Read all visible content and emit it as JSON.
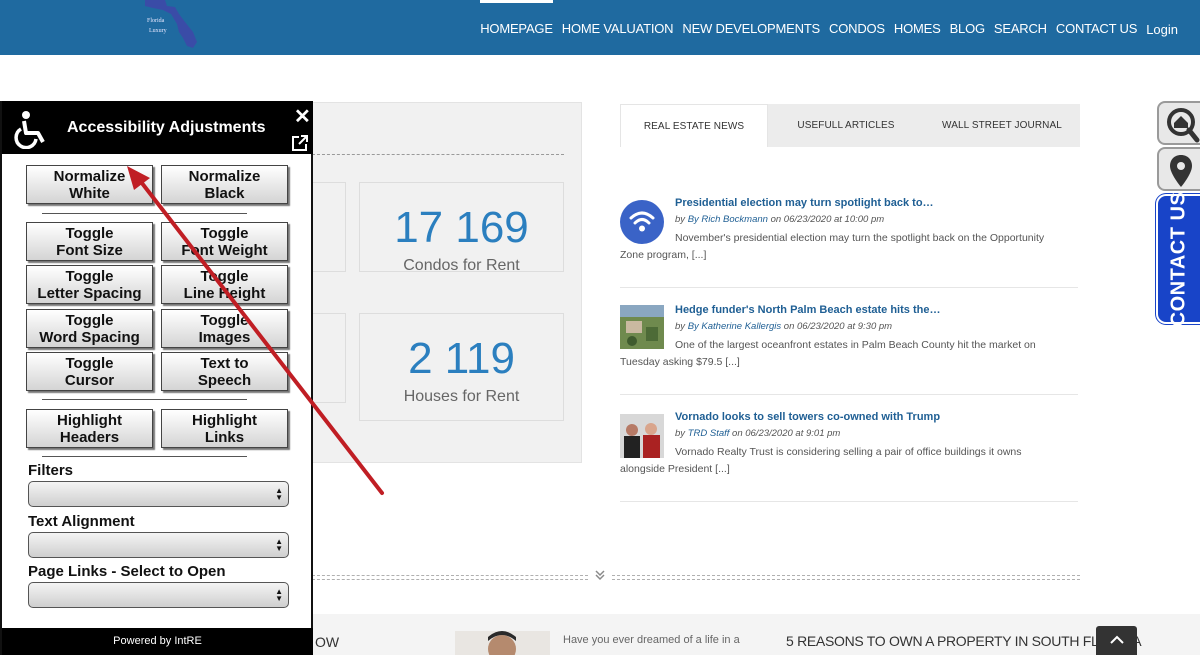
{
  "colors": {
    "header_bg": "#1f6aa0",
    "stat_number": "#2b7fbf",
    "link": "#1f5f94",
    "contact_tab": "#1844c8",
    "arrow": "#c01e24"
  },
  "nav": {
    "items": [
      "HOMEPAGE",
      "HOME VALUATION",
      "NEW DEVELOPMENTS",
      "CONDOS",
      "HOMES",
      "BLOG",
      "SEARCH",
      "CONTACT US"
    ],
    "login": "Login"
  },
  "stats": [
    {
      "number": "17 169",
      "label": "Condos for Rent"
    },
    {
      "number": "2 119",
      "label": "Houses for Rent"
    }
  ],
  "tabs": [
    "REAL ESTATE NEWS",
    "USEFULL ARTICLES",
    "WALL STREET JOURNAL"
  ],
  "news": [
    {
      "title": "Presidential election may turn spotlight back to…",
      "by": "by",
      "author": "By Rich Bockmann",
      "date": "on 06/23/2020 at 10:00 pm",
      "excerpt": "November's presidential election may turn the spotlight back on the Opportunity Zone program, [...]",
      "thumb": "wifi-feed-icon"
    },
    {
      "title": "Hedge funder's North Palm Beach estate hits the…",
      "by": "by",
      "author": "By Katherine Kallergis",
      "date": "on 06/23/2020 at 9:30 pm",
      "excerpt": "One of the largest oceanfront estates in Palm Beach County hit the market on Tuesday asking $79.5 [...]",
      "thumb": "aerial-photo"
    },
    {
      "title": "Vornado looks to sell towers co-owned with Trump",
      "by": "by",
      "author": "TRD Staff",
      "date": "on 06/23/2020 at 9:01 pm",
      "excerpt": "Vornado Realty Trust is considering selling a pair of office buildings it owns alongside President [...]",
      "thumb": "people-photo"
    }
  ],
  "bottom": {
    "partial_heading": "OW",
    "text": "Have you ever dreamed of a life in a",
    "heading": "5 REASONS TO OWN A PROPERTY IN SOUTH FLORIDA"
  },
  "side": {
    "contact_label": "CONTACT US",
    "icons": [
      "home-search-icon",
      "map-pin-icon"
    ]
  },
  "a11y": {
    "title": "Accessibility Adjustments",
    "buttons": [
      [
        "Normalize",
        "White"
      ],
      [
        "Normalize",
        "Black"
      ],
      [
        "Toggle",
        "Font Size"
      ],
      [
        "Toggle",
        "Font Weight"
      ],
      [
        "Toggle",
        "Letter Spacing"
      ],
      [
        "Toggle",
        "Line Height"
      ],
      [
        "Toggle",
        "Word Spacing"
      ],
      [
        "Toggle",
        "Images"
      ],
      [
        "Toggle",
        "Cursor"
      ],
      [
        "Text to",
        "Speech"
      ],
      [
        "Highlight",
        "Headers"
      ],
      [
        "Highlight",
        "Links"
      ]
    ],
    "filters_label": "Filters",
    "text_alignment_label": "Text Alignment",
    "page_links_label": "Page Links - Select to Open",
    "footer": "Powered by IntRE"
  }
}
